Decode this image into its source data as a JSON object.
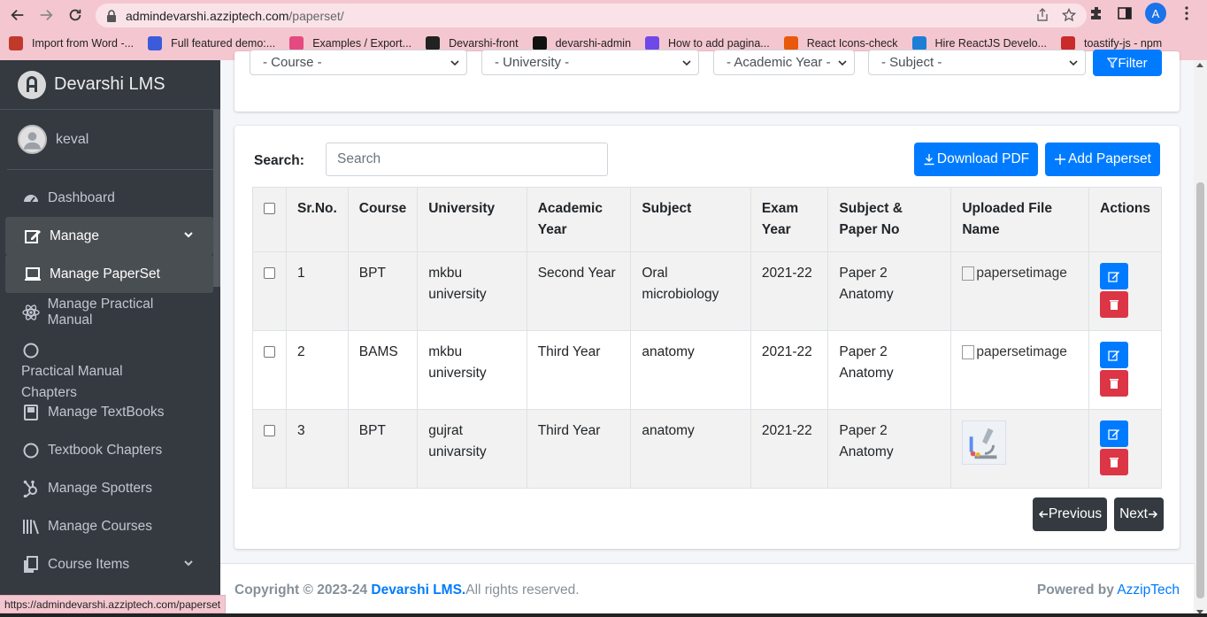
{
  "browser": {
    "url_host": "admindevarshi.azziptech.com",
    "url_path": "/paperset/",
    "profile_initial": "A",
    "bookmarks": [
      {
        "label": "Import from Word -...",
        "color": "#c0392b"
      },
      {
        "label": "Full featured demo:...",
        "color": "#3b5bdb"
      },
      {
        "label": "Examples / Export...",
        "color": "#e64980"
      },
      {
        "label": "Devarshi-front",
        "color": "#222222"
      },
      {
        "label": "devarshi-admin",
        "color": "#111111"
      },
      {
        "label": "How to add pagina...",
        "color": "#7048e8"
      },
      {
        "label": "React Icons-check",
        "color": "#e8590c"
      },
      {
        "label": "Hire ReactJS Develo...",
        "color": "#1c7ed6"
      },
      {
        "label": "toastify-js - npm",
        "color": "#c92a2a"
      }
    ],
    "status_url": "https://admindevarshi.azziptech.com/paperset"
  },
  "sidebar": {
    "brand": "Devarshi LMS",
    "user": "keval",
    "items": [
      {
        "label": "Dashboard",
        "icon": "tachometer-icon"
      },
      {
        "label": "Manage",
        "icon": "edit-icon"
      },
      {
        "label": "Manage PaperSet",
        "icon": "laptop-icon"
      },
      {
        "label": "Manage Practical Manual",
        "icon": "atom-icon"
      },
      {
        "label": "Practical Manual Chapters",
        "icon": "circle-icon"
      },
      {
        "label": "Manage TextBooks",
        "icon": "book-icon"
      },
      {
        "label": "Textbook Chapters",
        "icon": "circle-icon"
      },
      {
        "label": "Manage Spotters",
        "icon": "hubspot-icon"
      },
      {
        "label": "Manage Courses",
        "icon": "library-icon"
      },
      {
        "label": "Course Items",
        "icon": "copy-icon"
      }
    ]
  },
  "filters": {
    "course": "- Course -",
    "university": "- University -",
    "academic_year": "- Academic Year -",
    "subject": "- Subject -",
    "filter_label": "Filter"
  },
  "toolbar": {
    "search_label": "Search:",
    "search_placeholder": "Search",
    "download_pdf": "Download PDF",
    "add_paperset": "Add Paperset"
  },
  "table": {
    "headers": [
      "Sr.No.",
      "Course",
      "University",
      "Academic Year",
      "Subject",
      "Exam Year",
      "Subject & Paper No",
      "Uploaded File Name",
      "Actions"
    ],
    "rows": [
      {
        "sr": "1",
        "course": "BPT",
        "university": "mkbu university",
        "year": "Second Year",
        "subject": "Oral microbiology",
        "exam_year": "2021-22",
        "paper": "Paper 2 Anatomy",
        "file": "papersetimage"
      },
      {
        "sr": "2",
        "course": "BAMS",
        "university": "mkbu university",
        "year": "Third Year",
        "subject": "anatomy",
        "exam_year": "2021-22",
        "paper": "Paper 2 Anatomy",
        "file": "papersetimage"
      },
      {
        "sr": "3",
        "course": "BPT",
        "university": "gujrat univarsity",
        "year": "Third Year",
        "subject": "anatomy",
        "exam_year": "2021-22",
        "paper": "Paper 2 Anatomy",
        "file": ""
      }
    ]
  },
  "pagination": {
    "previous": "Previous",
    "next": "Next"
  },
  "footer": {
    "copyright_prefix": "Copyright © 2023-24",
    "brand": "Devarshi LMS.",
    "rights": "All rights reserved.",
    "powered_prefix": "Powered by",
    "powered_link": "AzzipTech"
  },
  "colors": {
    "primary": "#007bff",
    "danger": "#dc3545",
    "sidebar": "#343a40",
    "chrome": "#f4c7d0"
  }
}
